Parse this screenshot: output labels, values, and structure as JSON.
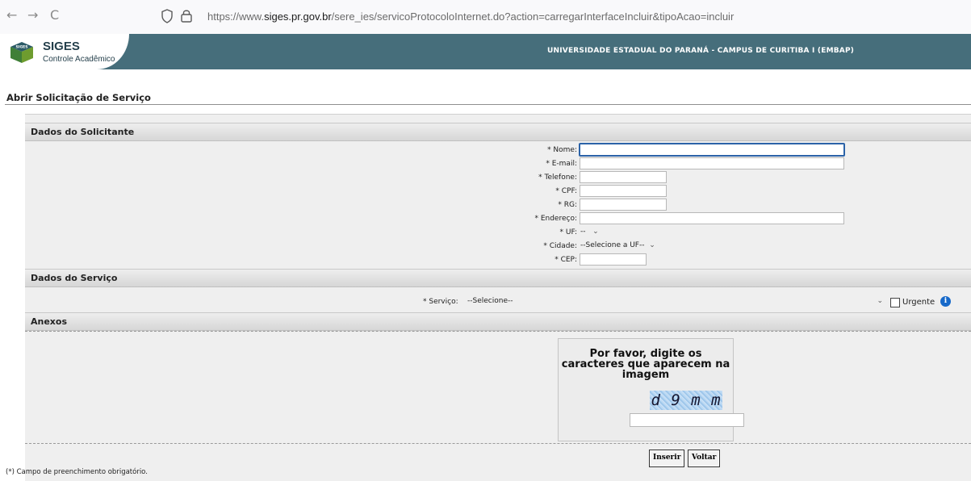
{
  "browser": {
    "url_prefix": "https://www.",
    "url_domain": "siges.pr.gov.br",
    "url_path": "/sere_ies/servicoProtocoloInternet.do?action=carregarInterfaceIncluir&tipoAcao=incluir",
    "back_glyph": "←",
    "forward_glyph": "→",
    "reload_glyph": "C",
    "icons": [
      "shield-icon",
      "lock-icon"
    ]
  },
  "header": {
    "logo_badge": "SIGES",
    "logo_title": "SIGES",
    "logo_subtitle": "Controle Acadêmico",
    "university": "UNIVERSIDADE ESTADUAL DO PARANÁ - CAMPUS DE CURITIBA I (EMBAP)",
    "colors": {
      "bar": "#466e7b",
      "title": "#243f4b"
    }
  },
  "page": {
    "title": "Abrir Solicitação de Serviço"
  },
  "sections": {
    "solicitante": "Dados do Solicitante",
    "servico": "Dados do Serviço",
    "anexos": "Anexos"
  },
  "fields": {
    "nome": "* Nome:",
    "email": "* E-mail:",
    "telefone": "* Telefone:",
    "cpf": "* CPF:",
    "rg": "* RG:",
    "endereco": "* Endereço:",
    "uf": "* UF:",
    "uf_value": "--",
    "cidade": "* Cidade:",
    "cidade_value": "--Selecione a UF--",
    "cep": "* CEP:",
    "servico": "* Serviço:",
    "servico_value": "--Selecione--",
    "urgente": "Urgente",
    "info_glyph": "i",
    "chevron": "⌄"
  },
  "captcha": {
    "prompt": "Por favor, digite os caracteres que aparecem na imagem",
    "image_text": "d 9 m m"
  },
  "buttons": {
    "inserir": "Inserir",
    "voltar": "Voltar"
  },
  "footnote": "(*) Campo de preenchimento obrigatório."
}
